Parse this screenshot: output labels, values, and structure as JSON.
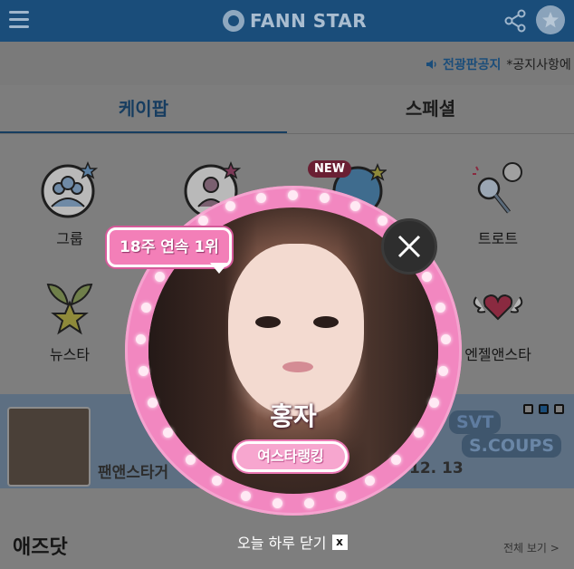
{
  "header": {
    "logo_text": "FANN STAR",
    "menu_icon": "hamburger-icon",
    "share_icon": "share-icon",
    "profile_icon": "star-profile-icon"
  },
  "notice": {
    "label": "전광판공지",
    "text": "*공지사항에"
  },
  "tabs": [
    {
      "label": "케이팝",
      "active": true
    },
    {
      "label": "스페셜",
      "active": false
    }
  ],
  "categories": [
    {
      "label": "그룹",
      "icon": "group-icon"
    },
    {
      "label": "트로트",
      "icon": "microphone-icon"
    },
    {
      "label": "뉴스타",
      "icon": "sprout-star-icon"
    },
    {
      "label": "엔젤앤스타",
      "icon": "winged-heart-icon"
    }
  ],
  "new_badge": "NEW",
  "banner": {
    "left_text": "팬앤스타거",
    "date_text": "12. 13",
    "tag1": "SVT",
    "tag2": "S.COUPS",
    "active_dot": 1
  },
  "section": {
    "title": "애즈닷",
    "see_all": "전체 보기 >"
  },
  "popup": {
    "badge": "18주 연속 1위",
    "name": "홍자",
    "ranking": "여스타랭킹",
    "close_icon": "close-icon"
  },
  "dismiss": {
    "label": "오늘 하루 닫기",
    "x": "x"
  },
  "colors": {
    "header": "#1a4d7a",
    "popup_pink": "#f287c0",
    "overlay": "#7e7e7e"
  }
}
